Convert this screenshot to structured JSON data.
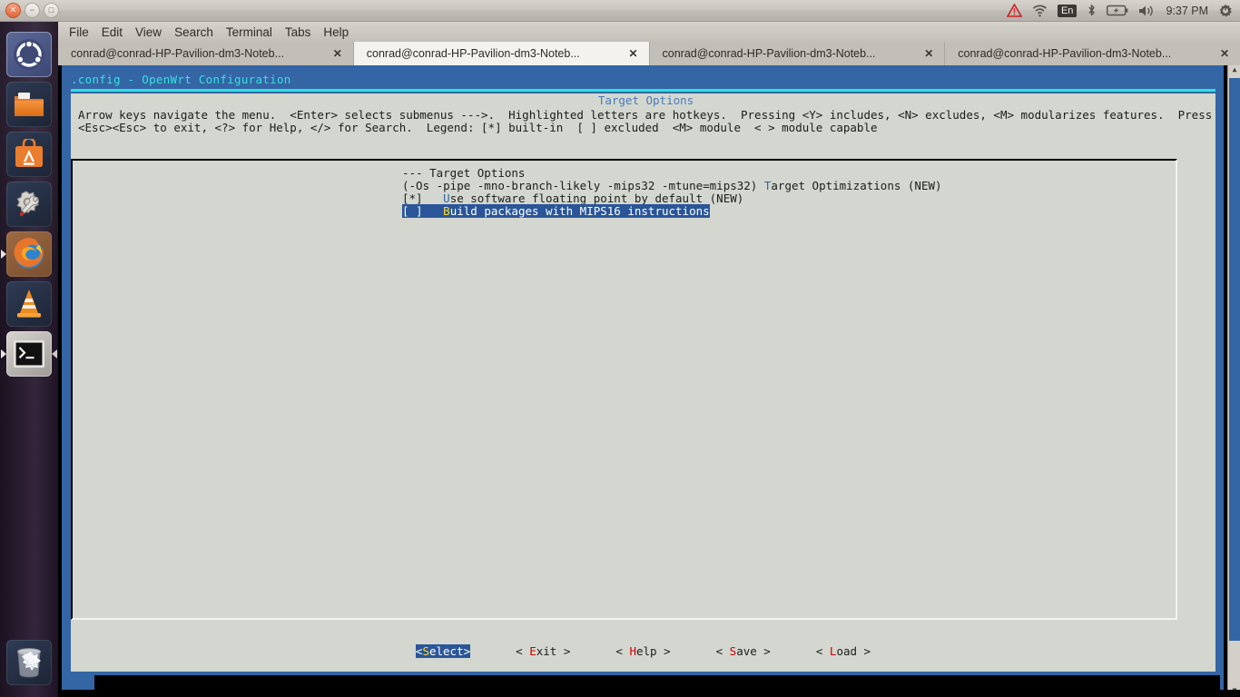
{
  "top_panel": {
    "window_controls": [
      {
        "name": "close",
        "glyph": "✕"
      },
      {
        "name": "minimize",
        "glyph": "−"
      },
      {
        "name": "maximize",
        "glyph": "□"
      }
    ],
    "tray": {
      "warning_icon": "warning-triangle-icon",
      "wifi_icon": "wifi-icon",
      "keyboard_layout": "En",
      "bluetooth_icon": "bluetooth-icon",
      "battery_icon": "battery-charging-icon",
      "volume_icon": "volume-icon",
      "clock": "9:37 PM",
      "session_icon": "gear-power-icon"
    }
  },
  "launcher": {
    "items": [
      {
        "name": "ubuntu-dash",
        "icon": "ubuntu-logo-icon",
        "active": false
      },
      {
        "name": "files",
        "icon": "folder-icon",
        "active": false
      },
      {
        "name": "software-center",
        "icon": "briefcase-a-icon",
        "active": false
      },
      {
        "name": "system-settings",
        "icon": "gear-wrench-icon",
        "active": false
      },
      {
        "name": "firefox",
        "icon": "firefox-icon",
        "active": false
      },
      {
        "name": "vlc",
        "icon": "traffic-cone-icon",
        "active": false
      },
      {
        "name": "terminal",
        "icon": "terminal-prompt-icon",
        "active": true
      }
    ],
    "trash": {
      "name": "trash",
      "icon": "trash-bin-icon"
    }
  },
  "terminal": {
    "menubar": [
      "File",
      "Edit",
      "View",
      "Search",
      "Terminal",
      "Tabs",
      "Help"
    ],
    "tabs": [
      {
        "label": "conrad@conrad-HP-Pavilion-dm3-Noteb...",
        "close": "✕",
        "active": false
      },
      {
        "label": "conrad@conrad-HP-Pavilion-dm3-Noteb...",
        "close": "✕",
        "active": true
      },
      {
        "label": "conrad@conrad-HP-Pavilion-dm3-Noteb...",
        "close": "✕",
        "active": false
      },
      {
        "label": "conrad@conrad-HP-Pavilion-dm3-Noteb...",
        "close": "✕",
        "active": false
      }
    ]
  },
  "dialog": {
    "title": ".config - OpenWrt Configuration",
    "frame_title": "Target Options",
    "help_line_1": "Arrow keys navigate the menu.  <Enter> selects submenus --->.  Highlighted letters are hotkeys.  Pressing <Y> includes, <N> excludes, <M> modularizes features.  Press",
    "help_line_2": "<Esc><Esc> to exit, <?> for Help, </> for Search.  Legend: [*] built-in  [ ] excluded  <M> module  < > module capable",
    "menu_rows": [
      {
        "type": "separator",
        "text": "--- Target Options",
        "selected": false
      },
      {
        "type": "choice",
        "prefix": "(-Os -pipe -mno-branch-likely -mips32 -mtune=mips32) ",
        "hotkey": "T",
        "rest": "arget Optimizations (NEW)",
        "selected": false
      },
      {
        "type": "bool",
        "prefix": "[*]   ",
        "hotkey": "U",
        "rest": "se software floating point by default (NEW)",
        "selected": false
      },
      {
        "type": "bool",
        "prefix": "[ ]   ",
        "hotkey": "B",
        "rest": "uild packages with MIPS16 instructions",
        "selected": true
      }
    ],
    "buttons": [
      {
        "left": "<",
        "hotkey": "S",
        "rest": "elect",
        "right": ">",
        "selected": true
      },
      {
        "left": "< ",
        "hotkey": "E",
        "rest": "xit",
        "right": " >",
        "selected": false
      },
      {
        "left": "< ",
        "hotkey": "H",
        "rest": "elp",
        "right": " >",
        "selected": false
      },
      {
        "left": "< ",
        "hotkey": "S",
        "rest": "ave",
        "right": " >",
        "selected": false
      },
      {
        "left": "< ",
        "hotkey": "L",
        "rest": "oad",
        "right": " >",
        "selected": false
      }
    ]
  },
  "colors": {
    "dialog_bg": "#3465a4",
    "panel_bg": "#d3d7cf",
    "title_cyan": "#34e2e2",
    "highlight_bg": "#2a5699",
    "hotkey_blue": "#3465a4",
    "hotkey_red": "#cc0000",
    "hotkey_yellow": "#ffd92b"
  }
}
